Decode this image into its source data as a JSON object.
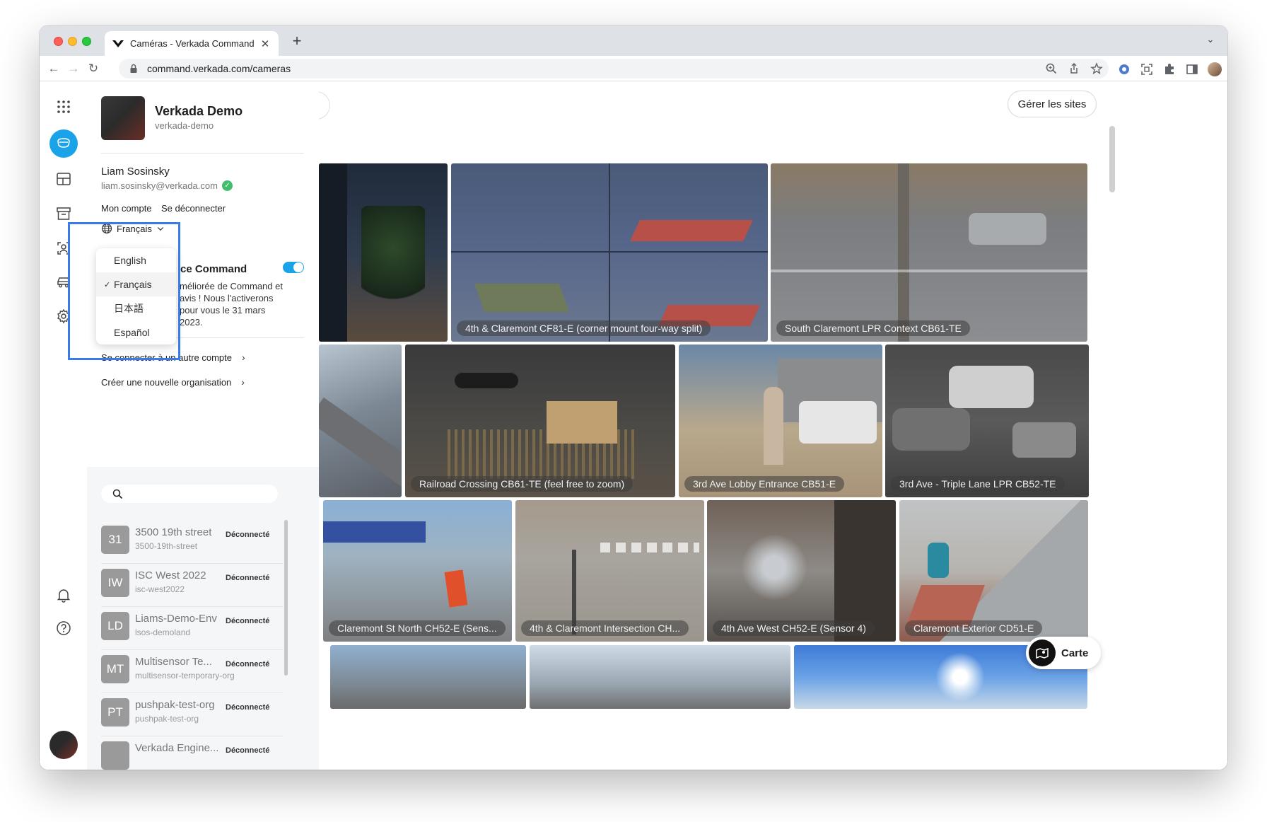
{
  "browser": {
    "tab_title": "Caméras - Verkada Command",
    "url": "command.verkada.com/cameras"
  },
  "org": {
    "name": "Verkada Demo",
    "slug": "verkada-demo"
  },
  "user": {
    "name": "Liam Sosinsky",
    "email": "liam.sosinsky@verkada.com",
    "my_account": "Mon compte",
    "logout": "Se déconnecter"
  },
  "language": {
    "current": "Français",
    "options": [
      "English",
      "Français",
      "日本語",
      "Español"
    ],
    "selected_index": 1
  },
  "feature": {
    "title": "ce Command",
    "description": "méliorée de Command et avis ! Nous l'activerons pour vous le 31 mars 2023.",
    "enabled": true
  },
  "menu": {
    "switch_account": "Se connecter à un autre compte",
    "create_org": "Créer une nouvelle organisation"
  },
  "org_search": {
    "placeholder": ""
  },
  "org_list": [
    {
      "initials": "31",
      "name": "3500 19th street",
      "slug": "3500-19th-street",
      "status": "Déconnecté"
    },
    {
      "initials": "IW",
      "name": "ISC West 2022",
      "slug": "isc-west2022",
      "status": "Déconnecté"
    },
    {
      "initials": "LD",
      "name": "Liams-Demo-Env",
      "slug": "lsos-demoland",
      "status": "Déconnecté"
    },
    {
      "initials": "MT",
      "name": "Multisensor Te...",
      "slug": "multisensor-temporary-org",
      "status": "Déconnecté"
    },
    {
      "initials": "PT",
      "name": "pushpak-test-org",
      "slug": "pushpak-test-org",
      "status": "Déconnecté"
    },
    {
      "initials": "",
      "name": "Verkada Engine...",
      "slug": "",
      "status": "Déconnecté"
    }
  ],
  "main": {
    "manage_sites": "Gérer les sites",
    "map_button": "Carte"
  },
  "cameras": [
    {
      "label": ""
    },
    {
      "label": "4th & Claremont CF81-E (corner mount four-way split)"
    },
    {
      "label": "South Claremont LPR Context CB61-TE"
    },
    {
      "label": ""
    },
    {
      "label": "Railroad Crossing CB61-TE (feel free to zoom)"
    },
    {
      "label": "3rd Ave Lobby Entrance CB51-E"
    },
    {
      "label": "3rd Ave - Triple Lane LPR CB52-TE"
    },
    {
      "label": "Claremont St North CH52-E (Sens..."
    },
    {
      "label": "4th & Claremont Intersection CH..."
    },
    {
      "label": "4th Ave West CH52-E (Sensor 4)"
    },
    {
      "label": "Claremont Exterior CD51-E"
    },
    {
      "label": ""
    },
    {
      "label": ""
    },
    {
      "label": ""
    }
  ],
  "colors": {
    "accent": "#1aa3e8",
    "highlight": "#3a7bea"
  }
}
